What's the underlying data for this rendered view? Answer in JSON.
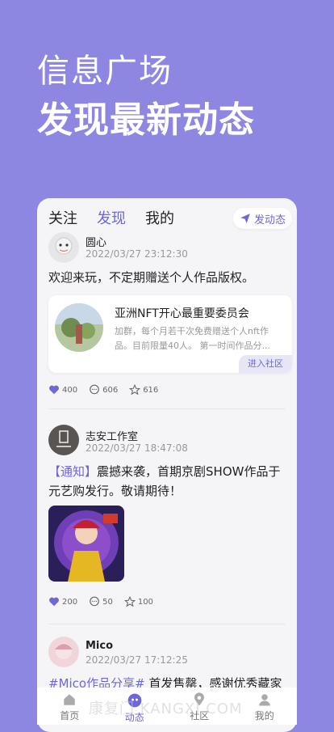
{
  "hero": {
    "title1": "信息广场",
    "title2": "发现最新动态"
  },
  "tabs": [
    {
      "label": "关注",
      "active": false
    },
    {
      "label": "发现",
      "active": true
    },
    {
      "label": "我的",
      "active": false
    }
  ],
  "post_button": {
    "label": "发动态",
    "icon": "paper-plane-icon"
  },
  "posts": [
    {
      "user": "圆心",
      "time": "2022/03/27 23:12:30",
      "content": "欢迎来玩，不定期赠送个人作品版权。",
      "club": {
        "title": "亚洲NFT开心最重要委员会",
        "desc": "加群，每个月若干次免费赠送个人nft作品。目前限量40人。 第一时间作品分...",
        "enter_label": "进入社区"
      },
      "likes": "400",
      "comments": "606",
      "favorites": "616"
    },
    {
      "user": "志安工作室",
      "time": "2022/03/27 18:47:08",
      "tag": "【通知】",
      "content": "震撼来袭，首期京剧SHOW作品于元艺购发行。敬请期待！",
      "likes": "200",
      "comments": "50",
      "favorites": "100"
    },
    {
      "user": "Mico",
      "time": "2022/03/27 17:12:25",
      "tag": "#Mico作品分享#",
      "content": " 首发售罄，感谢优秀藏家的"
    }
  ],
  "nav": [
    {
      "label": "首页",
      "icon": "home-icon",
      "active": false
    },
    {
      "label": "动态",
      "icon": "moments-icon",
      "active": true
    },
    {
      "label": "社区",
      "icon": "location-icon",
      "active": false
    },
    {
      "label": "我的",
      "icon": "user-icon",
      "active": false
    }
  ],
  "watermark": "康复门 KANGXI.COM",
  "colors": {
    "accent": "#6e67d8",
    "background": "#8d87e2"
  }
}
